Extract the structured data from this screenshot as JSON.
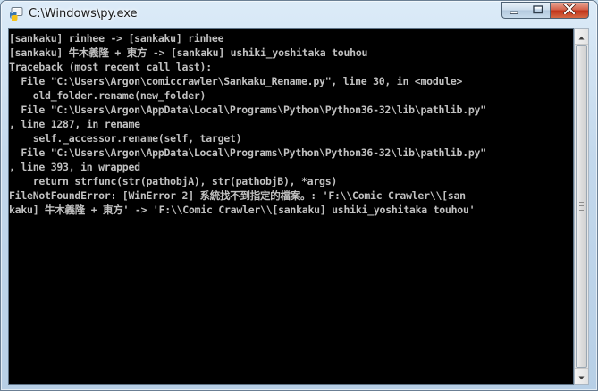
{
  "window": {
    "title": "C:\\Windows\\py.exe",
    "accent_close": "#c1341a",
    "frame_color": "#c3d8ec"
  },
  "icons": {
    "app": "python-launcher-icon",
    "minimize": "minimize-icon",
    "maximize": "maximize-icon",
    "close": "close-icon",
    "scroll_up": "arrow-up-icon",
    "scroll_down": "arrow-down-icon"
  },
  "console": {
    "background": "#000000",
    "foreground": "#c0c0c0",
    "lines": [
      "[sankaku] rinhee -> [sankaku] rinhee",
      "[sankaku] 牛木義隆 + 東方 -> [sankaku] ushiki_yoshitaka touhou",
      "Traceback (most recent call last):",
      "  File \"C:\\Users\\Argon\\comiccrawler\\Sankaku_Rename.py\", line 30, in <module>",
      "    old_folder.rename(new_folder)",
      "  File \"C:\\Users\\Argon\\AppData\\Local\\Programs\\Python\\Python36-32\\lib\\pathlib.py\"",
      ", line 1287, in rename",
      "    self._accessor.rename(self, target)",
      "  File \"C:\\Users\\Argon\\AppData\\Local\\Programs\\Python\\Python36-32\\lib\\pathlib.py\"",
      ", line 393, in wrapped",
      "    return strfunc(str(pathobjA), str(pathobjB), *args)",
      "FileNotFoundError: [WinError 2] 系統找不到指定的檔案。: 'F:\\\\Comic Crawler\\\\[san",
      "kaku] 牛木義隆 + 東方' -> 'F:\\\\Comic Crawler\\\\[sankaku] ushiki_yoshitaka touhou'"
    ]
  }
}
